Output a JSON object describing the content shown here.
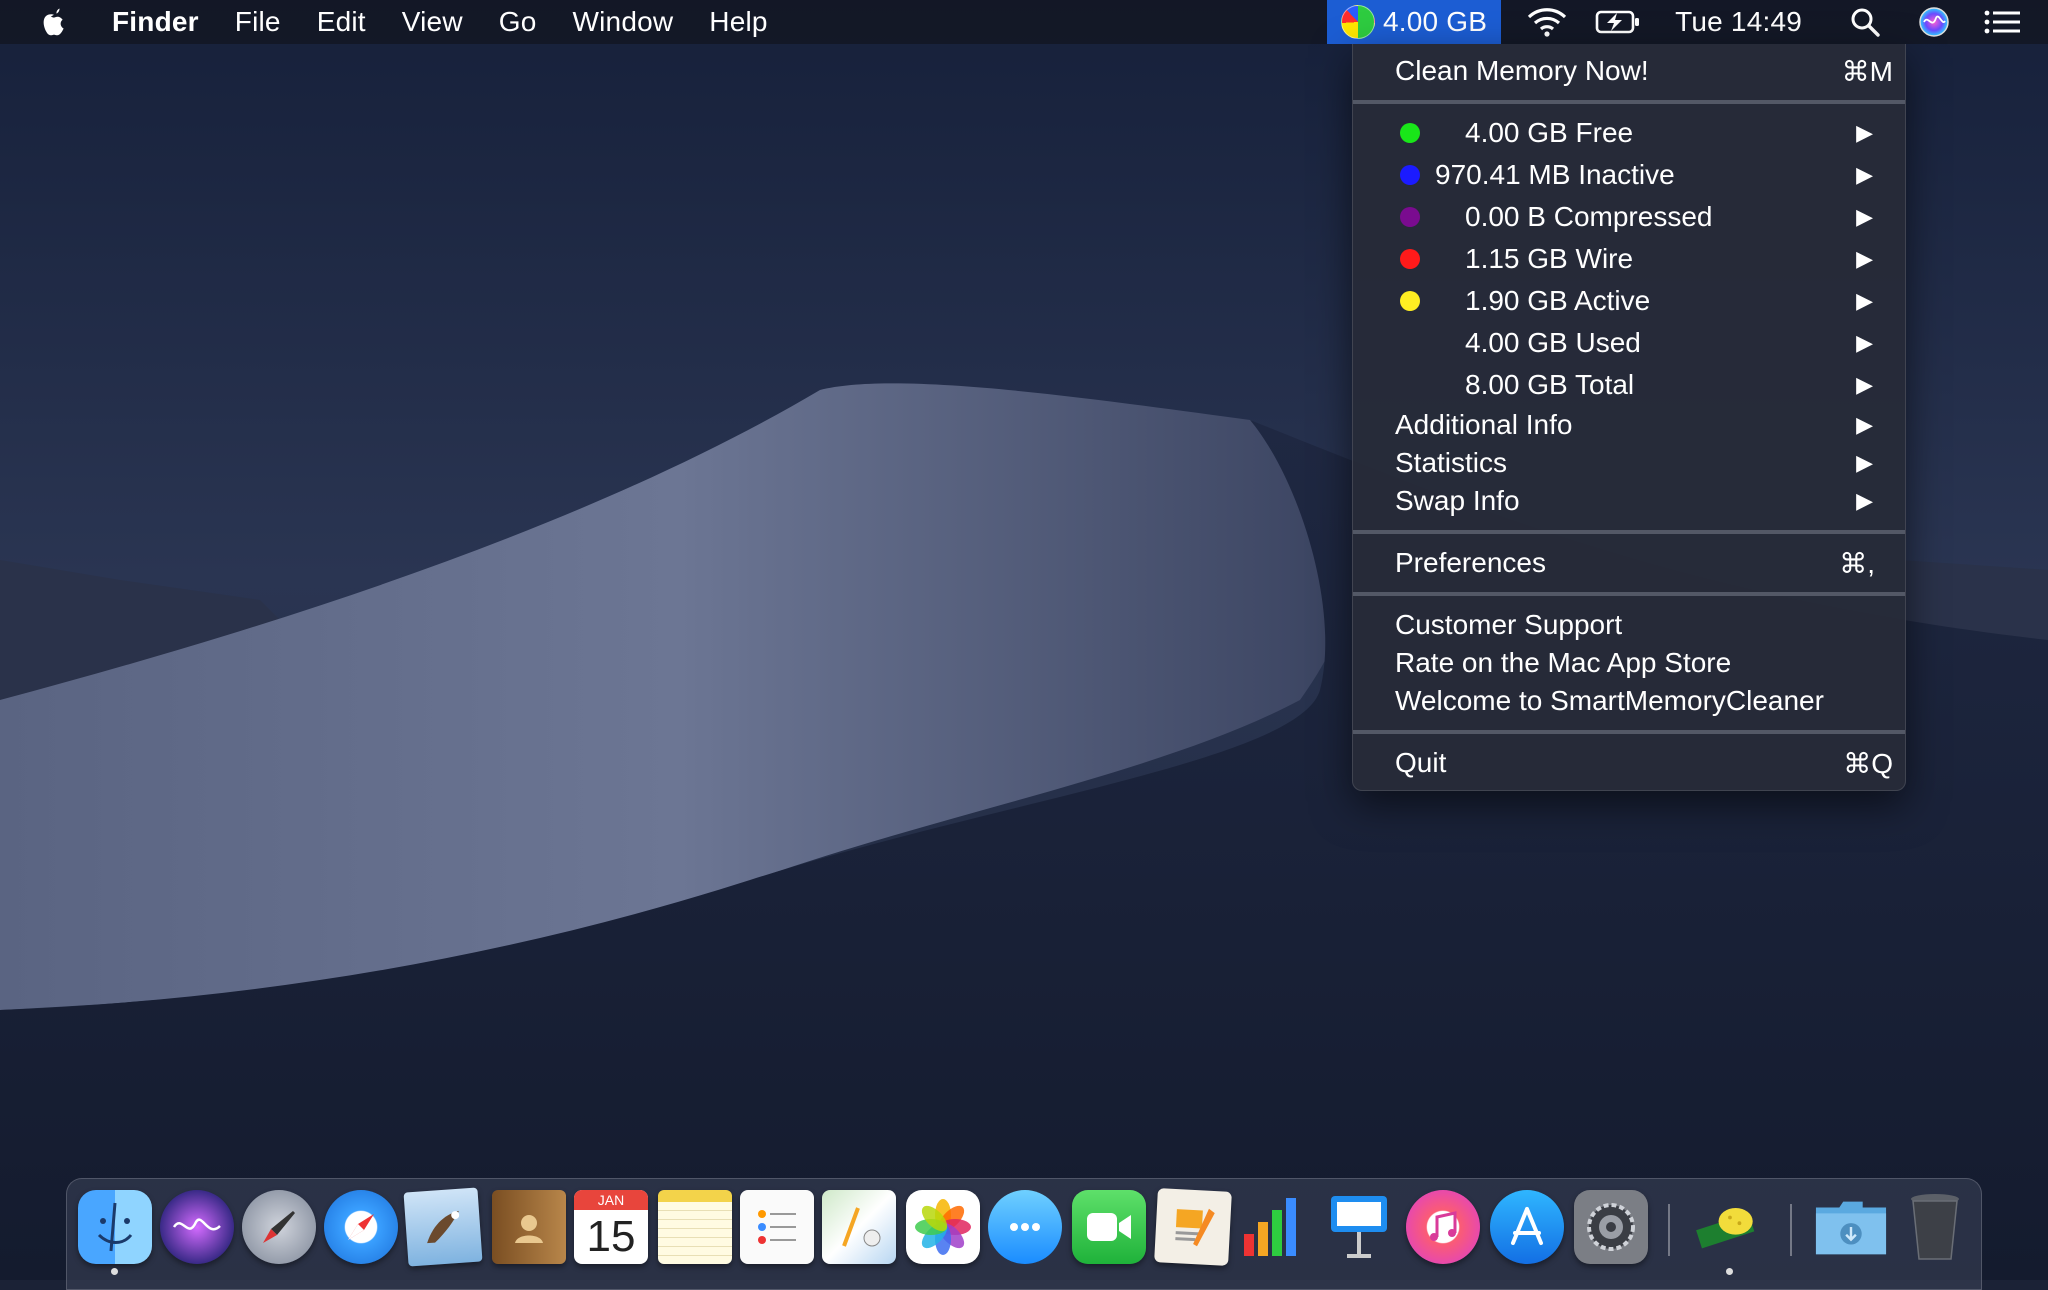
{
  "menubar": {
    "app_name": "Finder",
    "menus": [
      "File",
      "Edit",
      "View",
      "Go",
      "Window",
      "Help"
    ],
    "memory_status": "4.00 GB",
    "clock": "Tue 14:49"
  },
  "memory_menu": {
    "clean": {
      "label": "Clean Memory Now!",
      "shortcut": "⌘M"
    },
    "free": {
      "label": "4.00 GB Free",
      "color": "#19e619"
    },
    "inactive": {
      "label": "970.41 MB Inactive",
      "color": "#1b1bff"
    },
    "compressed": {
      "label": "0.00 B Compressed",
      "color": "#7a0b8f"
    },
    "wire": {
      "label": "1.15 GB Wire",
      "color": "#ff1a1a"
    },
    "active": {
      "label": "1.90 GB Active",
      "color": "#ffee22"
    },
    "used": {
      "label": "4.00 GB Used"
    },
    "total": {
      "label": "8.00 GB Total"
    },
    "additional_info": "Additional Info",
    "statistics": "Statistics",
    "swap_info": "Swap Info",
    "preferences": {
      "label": "Preferences",
      "shortcut": "⌘,"
    },
    "customer_support": "Customer Support",
    "rate": "Rate on the Mac App Store",
    "welcome": "Welcome to SmartMemoryCleaner",
    "quit": {
      "label": "Quit",
      "shortcut": "⌘Q"
    },
    "submenu_arrow": "▶"
  },
  "dock": {
    "calendar_month": "JAN",
    "calendar_day": "15"
  }
}
